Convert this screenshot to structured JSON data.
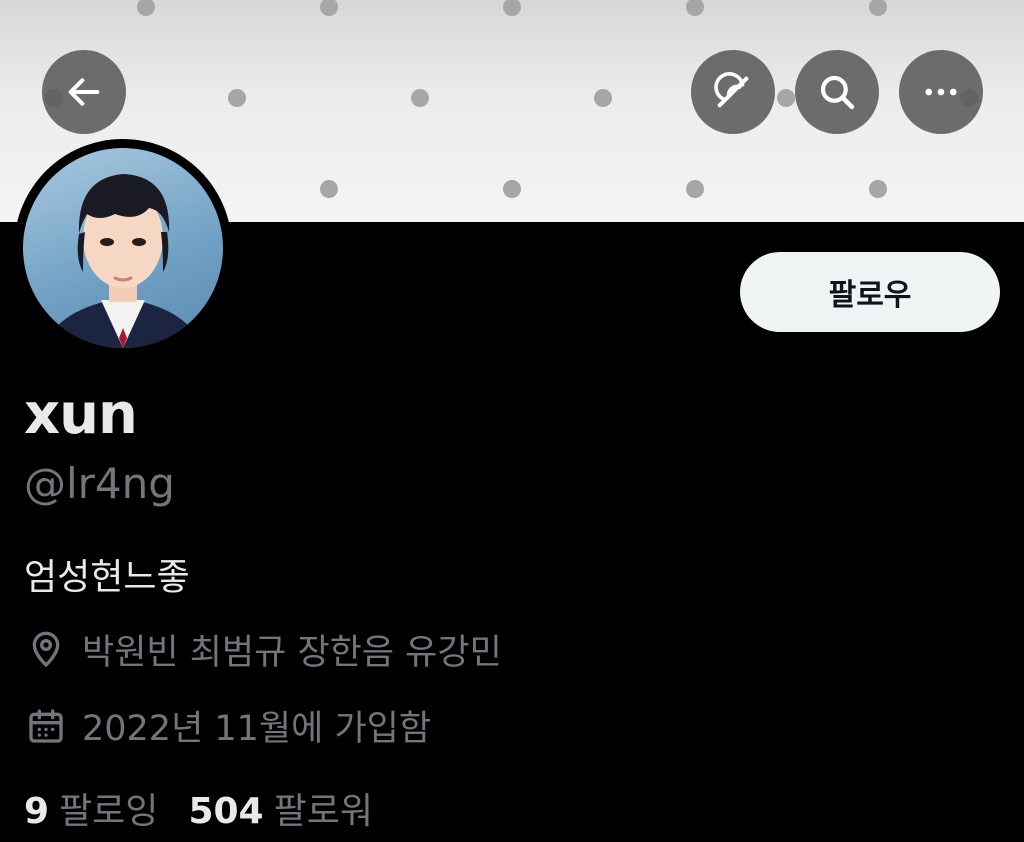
{
  "header": {
    "back_icon": "arrow-left-icon",
    "translate_icon": "grok-icon",
    "search_icon": "search-icon",
    "more_icon": "more-horizontal-icon"
  },
  "profile": {
    "display_name": "xun",
    "handle": "@lr4ng",
    "bio": "엄성현느좋",
    "location": "박원빈 최범규 장한음 유강민",
    "joined": "2022년 11월에 가입함",
    "follow_label": "팔로우"
  },
  "stats": {
    "following_count": "9",
    "following_label": "팔로잉",
    "followers_count": "504",
    "followers_label": "팔로워"
  },
  "colors": {
    "background": "#000000",
    "primary_text": "#e7e9ea",
    "secondary_text": "#71767b",
    "follow_button_bg": "#eff3f4"
  }
}
